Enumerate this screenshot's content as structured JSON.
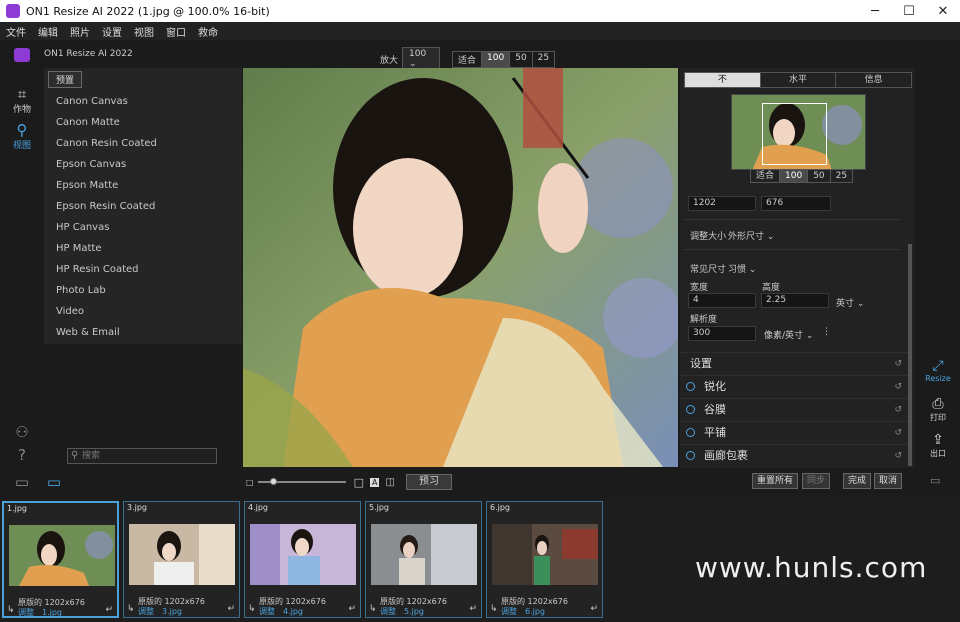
{
  "window": {
    "title": "ON1 Resize AI 2022 (1.jpg @ 100.0% 16-bit)",
    "min": "─",
    "max": "☐",
    "close": "✕"
  },
  "menu": [
    "文件",
    "编辑",
    "照片",
    "设置",
    "视图",
    "窗口",
    "救命"
  ],
  "app_name": "ON1 Resize AI 2022",
  "left_rail": {
    "crop_label": "作物",
    "view_label": "视图"
  },
  "presets": {
    "header": "预置",
    "items": [
      "Canon Canvas",
      "Canon Matte",
      "Canon Resin Coated",
      "Epson Canvas",
      "Epson Matte",
      "Epson Resin Coated",
      "HP Canvas",
      "HP Matte",
      "HP Resin Coated",
      "Photo Lab",
      "Video",
      "Web & Email"
    ],
    "search_placeholder": "搜索"
  },
  "zoom": {
    "label": "放大",
    "value": "100",
    "options": [
      "适合",
      "100",
      "50",
      "25"
    ],
    "active": "100"
  },
  "preview_bottom": {
    "practice": "预习",
    "a_label": "A"
  },
  "right_tabs": {
    "items": [
      "不",
      "水平",
      "信息"
    ],
    "active": "不"
  },
  "navigator": {
    "options": [
      "适合",
      "100",
      "50",
      "25"
    ]
  },
  "size": {
    "width_px": "1202",
    "height_px": "676",
    "resize_label": "调整大小",
    "resize_mode": "外形尺寸",
    "common_label": "常见尺寸",
    "common_value": "习惯",
    "width_label": "宽度",
    "height_label": "高度",
    "width": "4",
    "height": "2.25",
    "unit": "英寸",
    "res_label": "解析度",
    "res": "300",
    "res_unit": "像素/英寸"
  },
  "sections": {
    "settings": "设置",
    "items": [
      "锐化",
      "谷膜",
      "平铺",
      "画廊包裹"
    ]
  },
  "actions": {
    "reset_all": "重置所有",
    "sync": "同步",
    "done": "完成",
    "cancel": "取消"
  },
  "right_rail": {
    "resize": "Resize",
    "print": "打印",
    "export": "出口"
  },
  "thumbs": [
    {
      "name": "1.jpg",
      "orig": "原版的",
      "size": "1202x676",
      "adjust": "调整",
      "file": "1.jpg"
    },
    {
      "name": "3.jpg",
      "orig": "原版的",
      "size": "1202x676",
      "adjust": "调整",
      "file": "3.jpg"
    },
    {
      "name": "4.jpg",
      "orig": "原版的",
      "size": "1202x676",
      "adjust": "调整",
      "file": "4.jpg"
    },
    {
      "name": "5.jpg",
      "orig": "原版的",
      "size": "1202x676",
      "adjust": "调整",
      "file": "5.jpg"
    },
    {
      "name": "6.jpg",
      "orig": "原版的",
      "size": "1202x676",
      "adjust": "调整",
      "file": "6.jpg"
    }
  ],
  "watermark": "www.hunls.com",
  "colors": {
    "accent": "#4aa3e0",
    "brand": "#8e3bd6"
  }
}
